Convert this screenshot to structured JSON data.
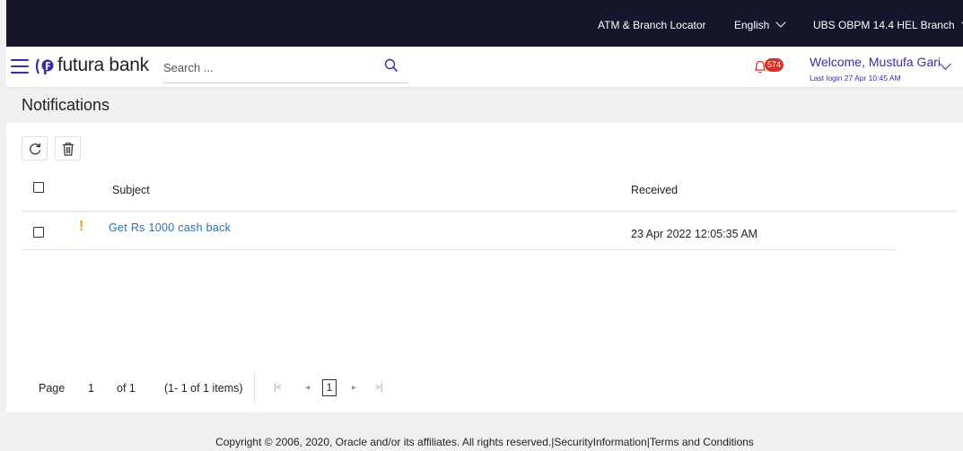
{
  "topbar": {
    "atm_locator": "ATM & Branch Locator",
    "language": "English",
    "branch": "UBS OBPM 14.4 HEL Branch"
  },
  "header": {
    "brand": "futura bank",
    "search": {
      "placeholder": "Search ...",
      "value": ""
    },
    "notification_count": "574",
    "welcome": "Welcome, Mustufa Gari",
    "last_login": "Last login 27 Apr 10:45 AM"
  },
  "page": {
    "title": "Notifications"
  },
  "table": {
    "columns": {
      "subject": "Subject",
      "received": "Received"
    },
    "rows": [
      {
        "priority_mark": "!",
        "subject": "Get Rs 1000 cash back",
        "received": "23 Apr 2022 12:05:35 AM"
      }
    ]
  },
  "pagination": {
    "page_label": "Page",
    "current_page": "1",
    "of_label": "of 1",
    "items_label": "(1- 1 of 1 items)",
    "first": "|<",
    "prev": "◂",
    "next": "▸",
    "last": ">|",
    "page_box": "1"
  },
  "footer": {
    "copyright": "Copyright © 2006, 2020, Oracle and/or its affiliates. All rights reserved.",
    "security": "SecurityInformation",
    "terms": "Terms and Conditions",
    "sep": "|"
  },
  "colors": {
    "topbar_bg": "#15152b",
    "brand_accent": "#3a2fa0",
    "link": "#2a6ebb",
    "badge": "#d93025",
    "priority": "#e6a400"
  },
  "icons": {
    "menu": "hamburger-icon",
    "search": "search-icon",
    "notifications": "bell-icon",
    "refresh": "refresh-icon",
    "delete": "trash-icon"
  }
}
